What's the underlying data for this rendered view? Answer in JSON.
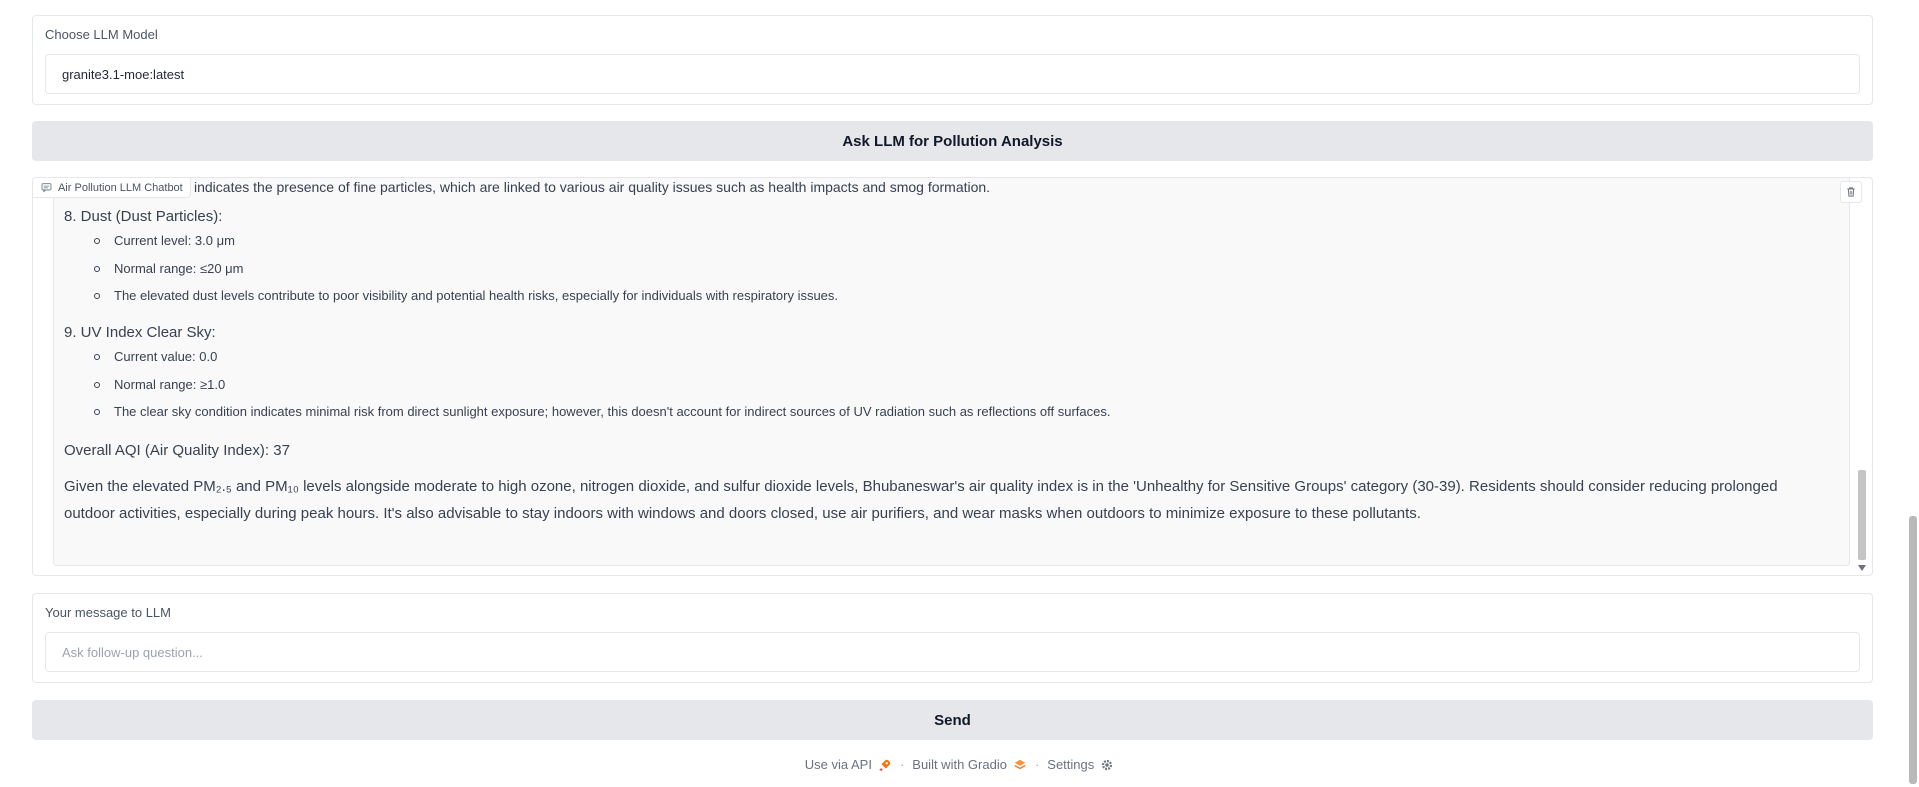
{
  "model_select": {
    "label": "Choose LLM Model",
    "value": "granite3.1-moe:latest"
  },
  "analyze_button": {
    "label": "Ask LLM for Pollution Analysis"
  },
  "chatbot": {
    "label": "Air Pollution LLM Chatbot",
    "partial_line": "indicates the presence of fine particles, which are linked to various air quality issues such as health impacts and smog formation.",
    "sections": [
      {
        "heading": "8. Dust (Dust Particles):",
        "bullets": [
          "Current level: 3.0 μm",
          "Normal range: ≤20 μm",
          "The elevated dust levels contribute to poor visibility and potential health risks, especially for individuals with respiratory issues."
        ]
      },
      {
        "heading": "9. UV Index Clear Sky:",
        "bullets": [
          "Current value: 0.0",
          "Normal range: ≥1.0",
          "The clear sky condition indicates minimal risk from direct sunlight exposure; however, this doesn't account for indirect sources of UV radiation such as reflections off surfaces."
        ]
      }
    ],
    "overall": "Overall AQI (Air Quality Index): 37",
    "summary": "Given the elevated PM₂.₅ and PM₁₀ levels alongside moderate to high ozone, nitrogen dioxide, and sulfur dioxide levels, Bhubaneswar's air quality index is in the 'Unhealthy for Sensitive Groups' category (30-39). Residents should consider reducing prolonged outdoor activities, especially during peak hours. It's also advisable to stay indoors with windows and doors closed, use air purifiers, and wear masks when outdoors to minimize exposure to these pollutants."
  },
  "message_input": {
    "label": "Your message to LLM",
    "placeholder": "Ask follow-up question..."
  },
  "send_button": {
    "label": "Send"
  },
  "footer": {
    "api": "Use via API",
    "built": "Built with Gradio",
    "settings": "Settings",
    "separator": "·"
  },
  "icons": {
    "api": "rocket-icon",
    "gradio": "gradio-logo-icon",
    "settings": "gear-icon",
    "chat": "chat-icon",
    "clear": "trash-icon"
  },
  "colors": {
    "button_bg": "#e5e7eb",
    "bubble_bg": "#f9f9f9",
    "gradio_orange": "#f97316"
  }
}
